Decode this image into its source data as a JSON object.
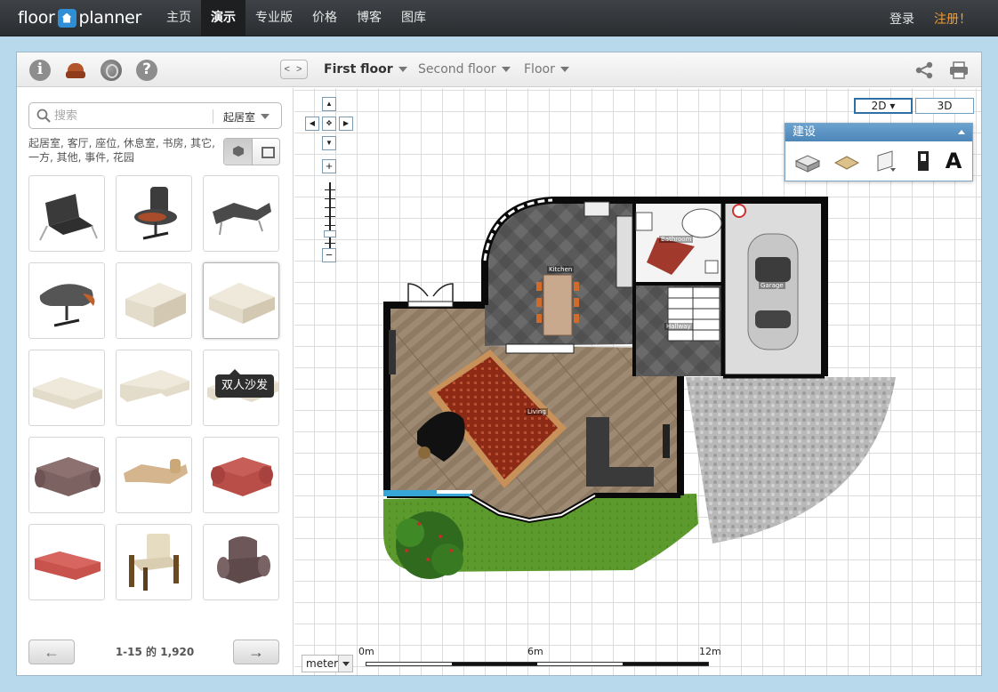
{
  "topbar": {
    "logo_left": "floor",
    "logo_right": "planner",
    "nav": [
      "主页",
      "演示",
      "专业版",
      "价格",
      "博客",
      "图库"
    ],
    "active_nav": "演示",
    "login": "登录",
    "register": "注册！"
  },
  "toolbar": {
    "left_icons": [
      "info-icon",
      "furniture-icon",
      "globe-icon",
      "help-icon"
    ],
    "floor_nav_label": "< >",
    "floors": [
      {
        "label": "First floor",
        "active": true
      },
      {
        "label": "Second floor",
        "active": false
      },
      {
        "label": "Floor",
        "active": false
      }
    ],
    "right_icons": [
      "share-icon",
      "print-icon"
    ]
  },
  "sidebar": {
    "search_placeholder": "搜索",
    "room_select": "起居室",
    "categories": "起居室, 客厅, 座位, 休息室, 书房, 其它, 一方, 其他, 事件, 花园",
    "tooltip": "双人沙发",
    "items": [
      {
        "name": "barcelona-chair",
        "color": "#3a3a3a"
      },
      {
        "name": "eames-lounge-chair",
        "color": "#3c3c3c"
      },
      {
        "name": "chaise-lounge",
        "color": "#4a4a4a"
      },
      {
        "name": "egg-chair",
        "color": "#555555"
      },
      {
        "name": "beige-armchair",
        "color": "#e4dccb"
      },
      {
        "name": "beige-loveseat",
        "color": "#e4dccb"
      },
      {
        "name": "beige-sofa",
        "color": "#e4dccb"
      },
      {
        "name": "beige-corner-sofa",
        "color": "#e4dccb"
      },
      {
        "name": "beige-l-sofa",
        "color": "#e4dccb"
      },
      {
        "name": "mauve-sofa",
        "color": "#7d6262"
      },
      {
        "name": "tan-chaise",
        "color": "#d4b58e"
      },
      {
        "name": "red-armchair",
        "color": "#b94d48"
      },
      {
        "name": "red-bench-sofa",
        "color": "#c8534c"
      },
      {
        "name": "wooden-armchair",
        "color": "#d9ceb1"
      },
      {
        "name": "mauve-armchair",
        "color": "#6e5758"
      }
    ],
    "pager_text": "1-15 的 1,920"
  },
  "canvas": {
    "view_modes": [
      "2D ▾",
      "3D"
    ],
    "active_view": "2D ▾",
    "build_panel_title": "建设",
    "build_tools": [
      "room-tool-icon",
      "floor-surface-icon",
      "wall-tool-icon",
      "door-tool-icon",
      "text-tool-icon"
    ],
    "text_tool_glyph": "A",
    "room_labels": [
      "Kitchen",
      "Bathroom",
      "Garage",
      "Hallway",
      "Living"
    ],
    "units": "meter",
    "scale_labels": [
      "0m",
      "6m",
      "12m"
    ],
    "nav_pad": {
      "up": "▲",
      "down": "▼",
      "left": "◀",
      "right": "▶",
      "center": "✥",
      "zoom_in": "+",
      "zoom_out": "−"
    }
  }
}
